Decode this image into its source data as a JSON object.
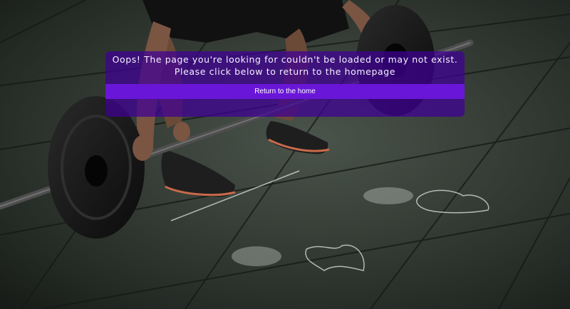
{
  "error": {
    "message_line1": "Oops! The page you're looking for couldn't be loaded or may not exist.",
    "message_line2": "Please click below to return to the homepage",
    "home_button_label": "Return to the home"
  },
  "colors": {
    "overlay": "#400096",
    "button": "#6a16d8",
    "text": "#ffffff"
  }
}
